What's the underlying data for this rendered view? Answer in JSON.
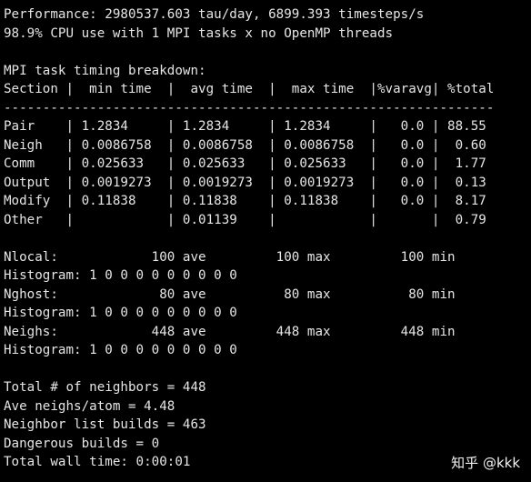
{
  "terminal": {
    "background_color": "#000000",
    "text_color": "#e6e6e6",
    "performance_line": "Performance: 2980537.603 tau/day, 6899.393 timesteps/s",
    "cpu_line": "98.9% CPU use with 1 MPI tasks x no OpenMP threads",
    "blank_1": "",
    "breakdown_title": "MPI task timing breakdown:",
    "table_header": "Section |  min time  |  avg time  |  max time  |%varavg| %total",
    "table_rule": "---------------------------------------------------------------",
    "row_pair": "Pair    | 1.2834     | 1.2834     | 1.2834     |   0.0 | 88.55",
    "row_neigh": "Neigh   | 0.0086758  | 0.0086758  | 0.0086758  |   0.0 |  0.60",
    "row_comm": "Comm    | 0.025633   | 0.025633   | 0.025633   |   0.0 |  1.77",
    "row_output": "Output  | 0.0019273  | 0.0019273  | 0.0019273  |   0.0 |  0.13",
    "row_modify": "Modify  | 0.11838    | 0.11838    | 0.11838    |   0.0 |  8.17",
    "row_other": "Other   |            | 0.01139    |            |       |  0.79",
    "blank_2": "",
    "nlocal_line": "Nlocal:            100 ave         100 max         100 min",
    "nlocal_histogram": "Histogram: 1 0 0 0 0 0 0 0 0 0",
    "nghost_line": "Nghost:             80 ave          80 max          80 min",
    "nghost_histogram": "Histogram: 1 0 0 0 0 0 0 0 0 0",
    "neighs_line": "Neighs:            448 ave         448 max         448 min",
    "neighs_histogram": "Histogram: 1 0 0 0 0 0 0 0 0 0",
    "blank_3": "",
    "total_neighbors": "Total # of neighbors = 448",
    "ave_neighs_per_atom": "Ave neighs/atom = 4.48",
    "neighbor_list_builds": "Neighbor list builds = 463",
    "dangerous_builds": "Dangerous builds = 0",
    "total_wall_time": "Total wall time: 0:00:01",
    "watermark": "知乎 @kkk"
  },
  "table_data": {
    "columns": [
      "Section",
      "min time",
      "avg time",
      "max time",
      "%varavg",
      "%total"
    ],
    "rows": [
      {
        "section": "Pair",
        "min_time": "1.2834",
        "avg_time": "1.2834",
        "max_time": "1.2834",
        "varavg": "0.0",
        "total": "88.55"
      },
      {
        "section": "Neigh",
        "min_time": "0.0086758",
        "avg_time": "0.0086758",
        "max_time": "0.0086758",
        "varavg": "0.0",
        "total": "0.60"
      },
      {
        "section": "Comm",
        "min_time": "0.025633",
        "avg_time": "0.025633",
        "max_time": "0.025633",
        "varavg": "0.0",
        "total": "1.77"
      },
      {
        "section": "Output",
        "min_time": "0.0019273",
        "avg_time": "0.0019273",
        "max_time": "0.0019273",
        "varavg": "0.0",
        "total": "0.13"
      },
      {
        "section": "Modify",
        "min_time": "0.11838",
        "avg_time": "0.11838",
        "max_time": "0.11838",
        "varavg": "0.0",
        "total": "8.17"
      },
      {
        "section": "Other",
        "min_time": "",
        "avg_time": "0.01139",
        "max_time": "",
        "varavg": "",
        "total": "0.79"
      }
    ],
    "stats": [
      {
        "name": "Nlocal",
        "ave": "100",
        "max": "100",
        "min": "100",
        "histogram": [
          1,
          0,
          0,
          0,
          0,
          0,
          0,
          0,
          0,
          0
        ]
      },
      {
        "name": "Nghost",
        "ave": "80",
        "max": "80",
        "min": "80",
        "histogram": [
          1,
          0,
          0,
          0,
          0,
          0,
          0,
          0,
          0,
          0
        ]
      },
      {
        "name": "Neighs",
        "ave": "448",
        "max": "448",
        "min": "448",
        "histogram": [
          1,
          0,
          0,
          0,
          0,
          0,
          0,
          0,
          0,
          0
        ]
      }
    ],
    "summary": {
      "total_neighbors": 448,
      "ave_neighs_per_atom": 4.48,
      "neighbor_list_builds": 463,
      "dangerous_builds": 0,
      "total_wall_time": "0:00:01"
    },
    "performance": {
      "tau_per_day": 2980537.603,
      "timesteps_per_second": 6899.393,
      "cpu_use_percent": 98.9,
      "mpi_tasks": 1,
      "openmp_threads": "no"
    }
  }
}
